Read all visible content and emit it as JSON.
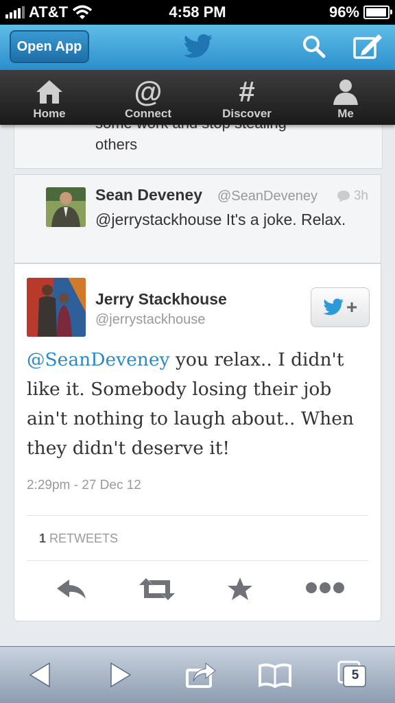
{
  "status_bar": {
    "carrier": "AT&T",
    "time": "4:58 PM",
    "battery": "96%",
    "battery_level": 0.96
  },
  "header": {
    "open_app_label": "Open App",
    "logo_icon": "twitter-bird-icon",
    "search_icon": "search-icon",
    "compose_icon": "compose-icon",
    "brand_color": "#2c8fcc"
  },
  "nav": {
    "items": [
      {
        "label": "Home",
        "icon": "home-icon"
      },
      {
        "label": "Connect",
        "icon": "at-icon"
      },
      {
        "label": "Discover",
        "icon": "hash-icon"
      },
      {
        "label": "Me",
        "icon": "person-icon"
      }
    ]
  },
  "previous_tweet": {
    "text_line1": "some work and stop stealing",
    "text_line2": "others"
  },
  "reply_tweet": {
    "name": "Sean Deveney",
    "handle": "@SeanDeveney",
    "time": "3h",
    "text": "@jerrystackhouse It's a joke. Relax."
  },
  "main_tweet": {
    "name": "Jerry Stackhouse",
    "handle": "@jerrystackhouse",
    "mention": "@SeanDeveney",
    "text": " you relax.. I didn't like it. Somebody losing their job ain't nothing to laugh about.. When they didn't deserve it!",
    "date": "2:29pm - 27 Dec 12",
    "retweet_count": "1",
    "retweet_label": " RETWEETS",
    "follow_plus": "+",
    "mention_color": "#2a8ac5"
  },
  "actions": [
    "reply-icon",
    "retweet-icon",
    "favorite-icon",
    "more-icon"
  ],
  "safari": {
    "tab_count": "5",
    "buttons": [
      "back-icon",
      "forward-icon",
      "share-icon",
      "bookmarks-icon",
      "tabs-icon"
    ]
  }
}
